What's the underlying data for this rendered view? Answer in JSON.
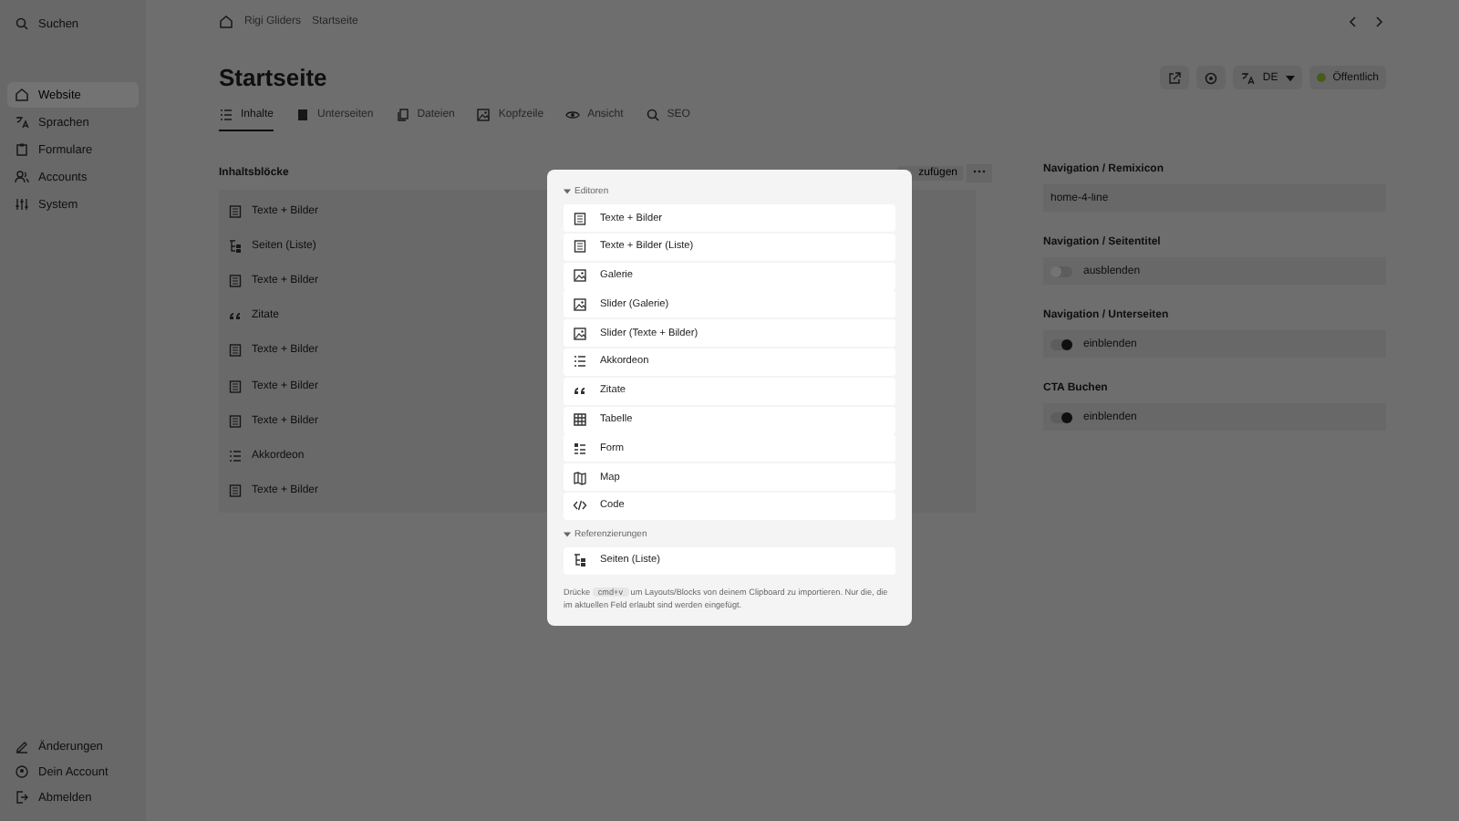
{
  "sidebar": {
    "search": "Suchen",
    "items": [
      {
        "label": "Website",
        "kind": "home",
        "selected": true
      },
      {
        "label": "Sprachen",
        "kind": "language",
        "selected": false
      },
      {
        "label": "Formulare",
        "kind": "clipboard",
        "selected": false
      },
      {
        "label": "Accounts",
        "kind": "users",
        "selected": false
      },
      {
        "label": "System",
        "kind": "sliders",
        "selected": false
      }
    ],
    "footer": [
      {
        "label": "Änderungen",
        "kind": "edit"
      },
      {
        "label": "Dein Account",
        "kind": "user"
      },
      {
        "label": "Abmelden",
        "kind": "logout"
      }
    ]
  },
  "breadcrumb": [
    "Rigi Gliders",
    "Startseite"
  ],
  "page": {
    "title": "Startseite",
    "language": "DE",
    "status": "Öffentlich"
  },
  "tabs": [
    {
      "label": "Inhalte",
      "kind": "list",
      "selected": true
    },
    {
      "label": "Unterseiten",
      "kind": "doc",
      "selected": false
    },
    {
      "label": "Dateien",
      "kind": "files",
      "selected": false
    },
    {
      "label": "Kopfzeile",
      "kind": "image",
      "selected": false
    },
    {
      "label": "Ansicht",
      "kind": "eye",
      "selected": false
    },
    {
      "label": "SEO",
      "kind": "search",
      "selected": false
    }
  ],
  "blocks": {
    "title": "Inhaltsblöcke",
    "add_button": "zufügen",
    "items": [
      {
        "label": "Texte + Bilder",
        "kind": "layout"
      },
      {
        "label": "Seiten (Liste)",
        "kind": "tree"
      },
      {
        "label": "Texte + Bilder",
        "kind": "layout"
      },
      {
        "label": "Zitate",
        "kind": "quote"
      },
      {
        "label": "Texte + Bilder",
        "kind": "layout"
      },
      {
        "label": "Texte + Bilder",
        "kind": "layout"
      },
      {
        "label": "Texte + Bilder",
        "kind": "layout"
      },
      {
        "label": "Akkordeon",
        "kind": "list"
      },
      {
        "label": "Texte + Bilder",
        "kind": "layout"
      }
    ]
  },
  "fields": [
    {
      "label": "Navigation / Remixicon",
      "kind": "text",
      "value": "home-4-line"
    },
    {
      "label": "Navigation / Seitentitel",
      "kind": "toggle",
      "value": "ausblenden",
      "checked": false
    },
    {
      "label": "Navigation / Unterseiten",
      "kind": "toggle",
      "value": "einblenden",
      "checked": true
    },
    {
      "label": "CTA Buchen",
      "kind": "toggle",
      "value": "einblenden",
      "checked": true
    }
  ],
  "modal": {
    "groups": [
      {
        "title": "Editoren",
        "items": [
          {
            "label": "Texte + Bilder",
            "kind": "layout"
          },
          {
            "label": "Texte + Bilder (Liste)",
            "kind": "layout"
          },
          {
            "label": "Galerie",
            "kind": "image"
          },
          {
            "label": "Slider (Galerie)",
            "kind": "image"
          },
          {
            "label": "Slider (Texte + Bilder)",
            "kind": "image"
          },
          {
            "label": "Akkordeon",
            "kind": "list"
          },
          {
            "label": "Zitate",
            "kind": "quote"
          },
          {
            "label": "Tabelle",
            "kind": "table"
          },
          {
            "label": "Form",
            "kind": "form"
          },
          {
            "label": "Map",
            "kind": "map"
          },
          {
            "label": "Code",
            "kind": "code"
          }
        ]
      },
      {
        "title": "Referenzierungen",
        "items": [
          {
            "label": "Seiten (Liste)",
            "kind": "tree"
          }
        ]
      }
    ],
    "hint_before": "Drücke",
    "shortcut": "cmd+v",
    "hint_after": "um Layouts/Blocks von deinem Clipboard zu importieren. Nur die, die im aktuellen Feld erlaubt sind werden eingefügt."
  }
}
